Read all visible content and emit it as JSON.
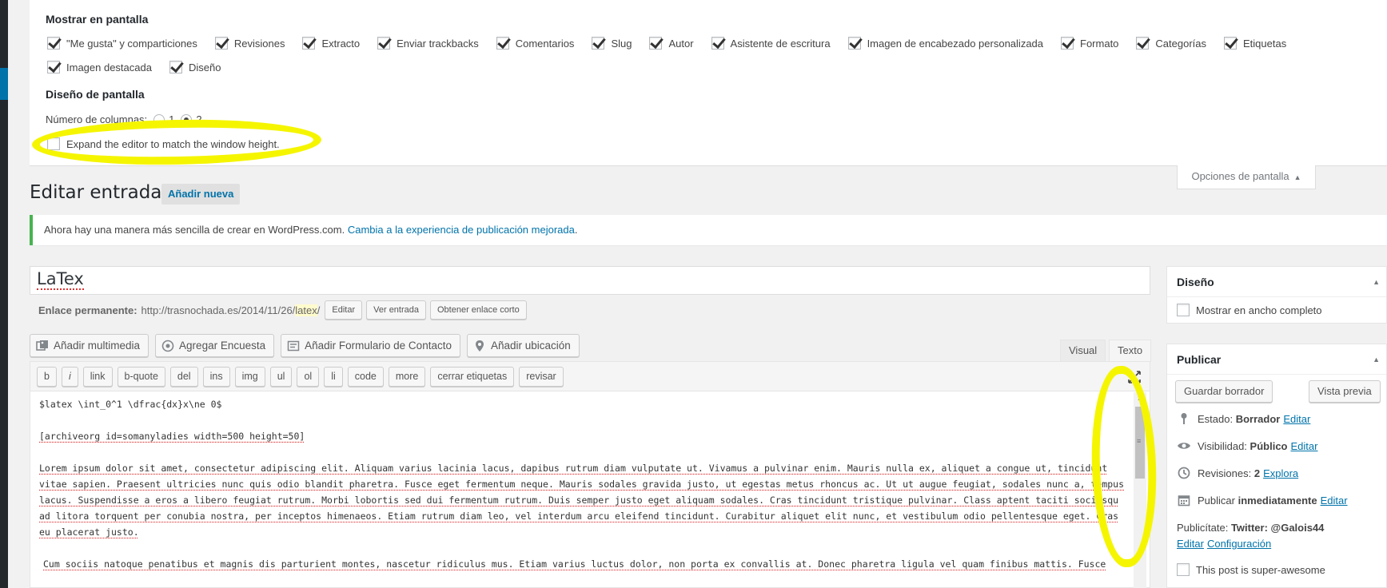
{
  "screen_options": {
    "show_heading": "Mostrar en pantalla",
    "boxes_row1": [
      {
        "label": "\"Me gusta\" y comparticiones",
        "checked": true
      },
      {
        "label": "Revisiones",
        "checked": true
      },
      {
        "label": "Extracto",
        "checked": true
      },
      {
        "label": "Enviar trackbacks",
        "checked": true
      },
      {
        "label": "Comentarios",
        "checked": true
      },
      {
        "label": "Slug",
        "checked": true
      },
      {
        "label": "Autor",
        "checked": true
      },
      {
        "label": "Asistente de escritura",
        "checked": true
      },
      {
        "label": "Imagen de encabezado personalizada",
        "checked": true
      },
      {
        "label": "Formato",
        "checked": true
      },
      {
        "label": "Categorías",
        "checked": true
      },
      {
        "label": "Etiquetas",
        "checked": true
      }
    ],
    "boxes_row2": [
      {
        "label": "Imagen destacada",
        "checked": true
      },
      {
        "label": "Diseño",
        "checked": true
      }
    ],
    "layout_heading": "Diseño de pantalla",
    "columns_label": "Número de columnas:",
    "column_option_1": "1",
    "column_option_2": "2",
    "columns_selected": "2",
    "expand_label": "Expand the editor to match the window height.",
    "expand_checked": false,
    "tab_label": "Opciones de pantalla",
    "highlight_color": "#f5f500"
  },
  "header": {
    "title": "Editar entrada",
    "add_new": "Añadir nueva"
  },
  "notice": {
    "text": "Ahora hay una manera más sencilla de crear en WordPress.com.",
    "link": "Cambia a la experiencia de publicación mejorada",
    "trail": ".",
    "accent": "#46b450"
  },
  "post": {
    "title": "LaTex",
    "permalink_label": "Enlace permanente:",
    "permalink_base": "http://trasnochada.es/2014/11/26/",
    "permalink_slug": "latex",
    "permalink_trail": "/",
    "edit_btn": "Editar",
    "view_btn": "Ver entrada",
    "shortlink_btn": "Obtener enlace corto"
  },
  "media_buttons": [
    {
      "label": "Añadir multimedia",
      "icon": "media-icon"
    },
    {
      "label": "Agregar Encuesta",
      "icon": "poll-icon"
    },
    {
      "label": "Añadir Formulario de Contacto",
      "icon": "form-icon"
    },
    {
      "label": "Añadir ubicación",
      "icon": "location-icon"
    }
  ],
  "editor_tabs": {
    "visual": "Visual",
    "text": "Texto",
    "active": "Texto"
  },
  "quicktags": [
    "b",
    "i",
    "link",
    "b-quote",
    "del",
    "ins",
    "img",
    "ul",
    "ol",
    "li",
    "code",
    "more",
    "cerrar etiquetas",
    "revisar"
  ],
  "content": {
    "line1": "$latex \\int_0^1 \\dfrac{dx}x\\ne 0$",
    "line2": "[archiveorg id=somanyladies width=500 height=50]",
    "para1": "Lorem ipsum dolor sit amet, consectetur adipiscing elit. Aliquam varius lacinia lacus, dapibus rutrum diam vulputate ut. Vivamus a pulvinar enim. Mauris nulla ex, aliquet a congue ut, tincidunt vitae sapien. Praesent ultricies nunc quis odio blandit pharetra. Fusce eget fermentum neque. Mauris sodales gravida justo, ut egestas metus rhoncus ac. Ut ut augue feugiat, sodales nunc a, tempus lacus. Suspendisse a eros a libero feugiat rutrum. Morbi lobortis sed dui fermentum rutrum. Duis semper justo eget aliquam sodales. Cras tincidunt tristique pulvinar. Class aptent taciti sociosqu ad litora torquent per conubia nostra, per inceptos himenaeos. Etiam rutrum diam leo, vel interdum arcu eleifend tincidunt. Curabitur aliquet elit nunc, et vestibulum odio pellentesque eget. Cras eu placerat justo.",
    "para2": "Cum sociis natoque penatibus et magnis dis parturient montes, nascetur ridiculus mus. Etiam varius luctus dolor, non porta ex convallis at. Donec pharetra ligula vel quam finibus mattis. Fusce"
  },
  "sidebar": {
    "diseno": {
      "title": "Diseño",
      "full_width_label": "Mostrar en ancho completo"
    },
    "publicar": {
      "title": "Publicar",
      "save_draft": "Guardar borrador",
      "preview": "Vista previa",
      "status_label": "Estado:",
      "status_value": "Borrador",
      "status_edit": "Editar",
      "visibility_label": "Visibilidad:",
      "visibility_value": "Público",
      "visibility_edit": "Editar",
      "revisions_label": "Revisiones:",
      "revisions_value": "2",
      "revisions_link": "Explora",
      "publish_label": "Publicar",
      "publish_value": "inmediatamente",
      "publish_edit": "Editar",
      "publicize_label": "Publicítate:",
      "publicize_value": "Twitter: @Galois44",
      "publicize_edit": "Editar",
      "publicize_config": "Configuración",
      "super_label": "This post is super-awesome"
    }
  }
}
